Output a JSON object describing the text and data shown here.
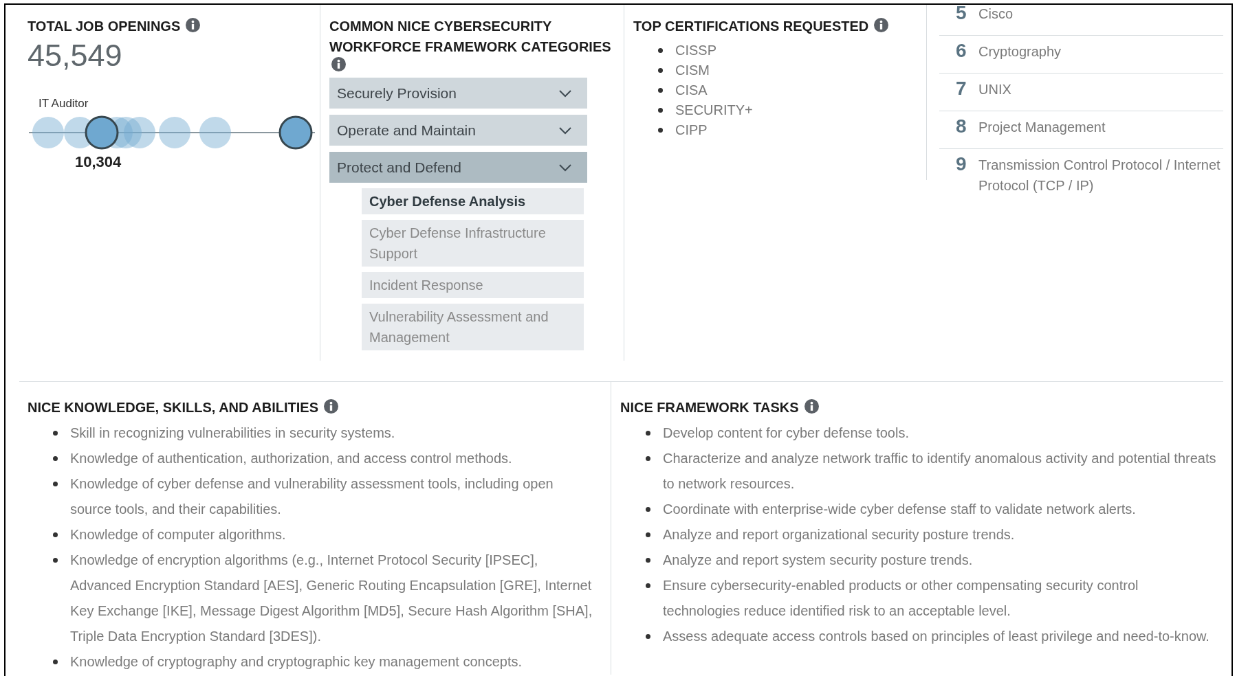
{
  "total_job_openings": {
    "title": "TOTAL JOB OPENINGS",
    "value": "45,549",
    "highlight": {
      "label": "IT Auditor",
      "value": "10,304"
    }
  },
  "framework_categories": {
    "title": "COMMON NICE CYBERSECURITY WORKFORCE FRAMEWORK CATEGORIES",
    "categories": [
      {
        "label": "Securely Provision",
        "expanded": false
      },
      {
        "label": "Operate and Maintain",
        "expanded": false
      },
      {
        "label": "Protect and Defend",
        "expanded": true,
        "children": [
          {
            "label": "Cyber Defense Analysis",
            "selected": true
          },
          {
            "label": "Cyber Defense Infrastructure Support",
            "selected": false
          },
          {
            "label": "Incident Response",
            "selected": false
          },
          {
            "label": "Vulnerability Assessment and Management",
            "selected": false
          }
        ]
      }
    ]
  },
  "top_certifications": {
    "title": "TOP CERTIFICATIONS REQUESTED",
    "items": [
      "CISSP",
      "CISM",
      "CISA",
      "SECURITY+",
      "CIPP"
    ]
  },
  "ranked_skills": [
    {
      "rank": "5",
      "label": "Cisco"
    },
    {
      "rank": "6",
      "label": "Cryptography"
    },
    {
      "rank": "7",
      "label": "UNIX"
    },
    {
      "rank": "8",
      "label": "Project Management"
    },
    {
      "rank": "9",
      "label": "Transmission Control Protocol / Internet Protocol (TCP / IP)"
    }
  ],
  "ksa": {
    "title": "NICE KNOWLEDGE, SKILLS, AND ABILITIES",
    "items": [
      "Skill in recognizing vulnerabilities in security systems.",
      "Knowledge of authentication, authorization, and access control methods.",
      "Knowledge of cyber defense and vulnerability assessment tools, including open source tools, and their capabilities.",
      "Knowledge of computer algorithms.",
      "Knowledge of encryption algorithms (e.g., Internet Protocol Security [IPSEC], Advanced Encryption Standard [AES], Generic Routing Encapsulation [GRE], Internet Key Exchange [IKE], Message Digest Algorithm [MD5], Secure Hash Algorithm [SHA], Triple Data Encryption Standard [3DES]).",
      "Knowledge of cryptography and cryptographic key management concepts."
    ]
  },
  "tasks": {
    "title": "NICE FRAMEWORK TASKS",
    "items": [
      "Develop content for cyber defense tools.",
      "Characterize and analyze network traffic to identify anomalous activity and potential threats to network resources.",
      "Coordinate with enterprise-wide cyber defense staff to validate network alerts.",
      "Analyze and report organizational security posture trends.",
      "Analyze and report system security posture trends.",
      "Ensure cybersecurity-enabled products or other compensating security control technologies reduce identified risk to an acceptable level.",
      "Assess adequate access controls based on principles of least privilege and need-to-know."
    ]
  }
}
